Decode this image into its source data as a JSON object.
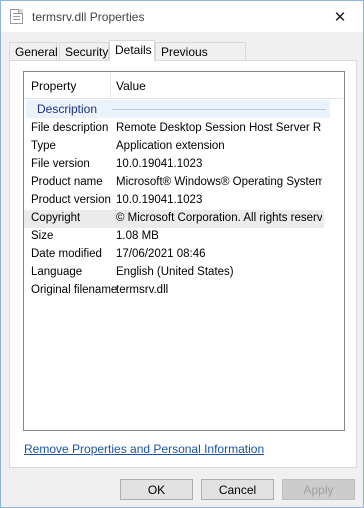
{
  "window": {
    "title": "termsrv.dll Properties",
    "close_glyph": "✕"
  },
  "tabs": [
    {
      "label": "General"
    },
    {
      "label": "Security"
    },
    {
      "label": "Details"
    },
    {
      "label": "Previous Versions"
    }
  ],
  "details": {
    "columns": {
      "property": "Property",
      "value": "Value"
    },
    "group": "Description",
    "rows": [
      {
        "property": "File description",
        "value": "Remote Desktop Session Host Server R..."
      },
      {
        "property": "Type",
        "value": "Application extension"
      },
      {
        "property": "File version",
        "value": "10.0.19041.1023"
      },
      {
        "property": "Product name",
        "value": "Microsoft® Windows® Operating System"
      },
      {
        "property": "Product version",
        "value": "10.0.19041.1023"
      },
      {
        "property": "Copyright",
        "value": "© Microsoft Corporation. All rights reserv..."
      },
      {
        "property": "Size",
        "value": "1.08 MB"
      },
      {
        "property": "Date modified",
        "value": "17/06/2021 08:46"
      },
      {
        "property": "Language",
        "value": "English (United States)"
      },
      {
        "property": "Original filename",
        "value": "termsrv.dll"
      }
    ]
  },
  "link": "Remove Properties and Personal Information",
  "buttons": {
    "ok": "OK",
    "cancel": "Cancel",
    "apply": "Apply"
  }
}
